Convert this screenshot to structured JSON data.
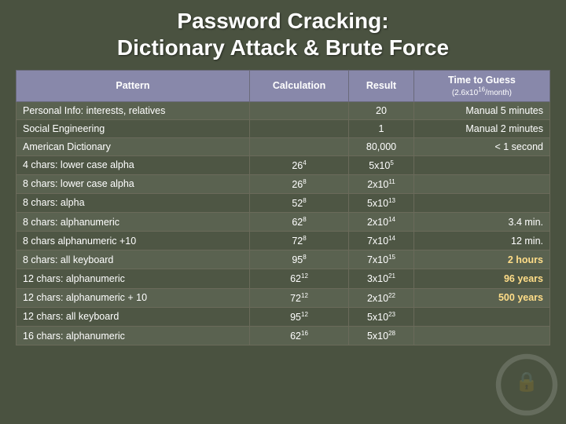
{
  "title": {
    "line1": "Password Cracking:",
    "line2": "Dictionary Attack & Brute Force"
  },
  "table": {
    "headers": [
      {
        "label": "Pattern"
      },
      {
        "label": "Calculation"
      },
      {
        "label": "Result"
      },
      {
        "label": "Time to Guess",
        "sub": "(2.6x10¹⁶/month)"
      }
    ],
    "rows": [
      {
        "pattern": "Personal Info: interests, relatives",
        "calc": "",
        "result": "20",
        "time": "Manual 5 minutes",
        "highlight": false
      },
      {
        "pattern": "Social Engineering",
        "calc": "",
        "result": "1",
        "time": "Manual 2 minutes",
        "highlight": false
      },
      {
        "pattern": "American Dictionary",
        "calc": "",
        "result": "80,000",
        "time": "< 1 second",
        "highlight": false
      },
      {
        "pattern": "4 chars: lower case alpha",
        "calc": "26⁴",
        "result": "5x10⁵",
        "time": "",
        "highlight": false
      },
      {
        "pattern": "8 chars: lower case alpha",
        "calc": "26⁸",
        "result": "2x10¹¹",
        "time": "",
        "highlight": false
      },
      {
        "pattern": "8 chars: alpha",
        "calc": "52⁸",
        "result": "5x10¹³",
        "time": "",
        "highlight": false
      },
      {
        "pattern": "8 chars: alphanumeric",
        "calc": "62⁸",
        "result": "2x10¹⁴",
        "time": "3.4 min.",
        "highlight": false
      },
      {
        "pattern": "8 chars alphanumeric +10",
        "calc": "72⁸",
        "result": "7x10¹⁴",
        "time": "12 min.",
        "highlight": false
      },
      {
        "pattern": "8 chars: all keyboard",
        "calc": "95⁸",
        "result": "7x10¹⁵",
        "time": "2 hours",
        "highlight": true
      },
      {
        "pattern": "12 chars: alphanumeric",
        "calc": "62¹²",
        "result": "3x10²¹",
        "time": "96 years",
        "highlight": true
      },
      {
        "pattern": "12 chars: alphanumeric + 10",
        "calc": "72¹²",
        "result": "2x10²²",
        "time": "500 years",
        "highlight": true
      },
      {
        "pattern": "12 chars: all keyboard",
        "calc": "95¹²",
        "result": "5x10²³",
        "time": "",
        "highlight": false
      },
      {
        "pattern": "16 chars: alphanumeric",
        "calc": "62¹⁶",
        "result": "5x10²⁸",
        "time": "",
        "highlight": false
      }
    ]
  }
}
